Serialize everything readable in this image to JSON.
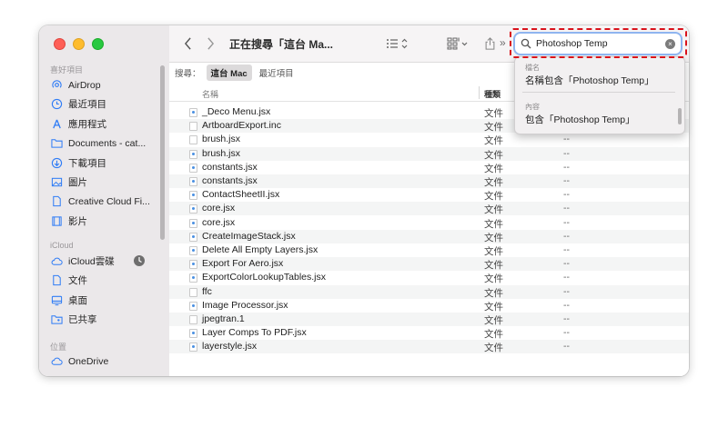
{
  "sidebar": {
    "section_favorites": "喜好項目",
    "favorites": [
      {
        "label": "AirDrop",
        "icon": "airdrop-icon"
      },
      {
        "label": "最近項目",
        "icon": "clock-icon"
      },
      {
        "label": "應用程式",
        "icon": "apps-icon"
      },
      {
        "label": "Documents - cat...",
        "icon": "folder-icon"
      },
      {
        "label": "下載項目",
        "icon": "download-icon"
      },
      {
        "label": "圖片",
        "icon": "photo-icon"
      },
      {
        "label": "Creative Cloud Fi...",
        "icon": "document-icon"
      },
      {
        "label": "影片",
        "icon": "film-icon"
      }
    ],
    "section_icloud": "iCloud",
    "icloud": [
      {
        "label": "iCloud雲碟",
        "icon": "cloud-icon"
      },
      {
        "label": "文件",
        "icon": "document-icon"
      },
      {
        "label": "桌面",
        "icon": "desktop-icon"
      },
      {
        "label": "已共享",
        "icon": "shared-folder-icon"
      }
    ],
    "section_locations": "位置",
    "locations": [
      {
        "label": "OneDrive",
        "icon": "cloud-icon"
      }
    ]
  },
  "toolbar": {
    "title": "正在搜尋「這台 Ma...",
    "more_glyph": "»"
  },
  "scope": {
    "label": "搜尋：",
    "selected": "這台 Mac",
    "other": "最近項目"
  },
  "columns": {
    "name": "名稱",
    "kind": "種類"
  },
  "files": [
    {
      "name": "_Deco Menu.jsx",
      "kind": "文件",
      "extra": "--",
      "js": true
    },
    {
      "name": "ArtboardExport.inc",
      "kind": "文件",
      "extra": "--",
      "js": false
    },
    {
      "name": "brush.jsx",
      "kind": "文件",
      "extra": "--",
      "js": false
    },
    {
      "name": "brush.jsx",
      "kind": "文件",
      "extra": "--",
      "js": true
    },
    {
      "name": "constants.jsx",
      "kind": "文件",
      "extra": "--",
      "js": true
    },
    {
      "name": "constants.jsx",
      "kind": "文件",
      "extra": "--",
      "js": true
    },
    {
      "name": "ContactSheetII.jsx",
      "kind": "文件",
      "extra": "--",
      "js": true
    },
    {
      "name": "core.jsx",
      "kind": "文件",
      "extra": "--",
      "js": true
    },
    {
      "name": "core.jsx",
      "kind": "文件",
      "extra": "--",
      "js": true
    },
    {
      "name": "CreateImageStack.jsx",
      "kind": "文件",
      "extra": "--",
      "js": true
    },
    {
      "name": "Delete All Empty Layers.jsx",
      "kind": "文件",
      "extra": "--",
      "js": true
    },
    {
      "name": "Export For Aero.jsx",
      "kind": "文件",
      "extra": "--",
      "js": true
    },
    {
      "name": "ExportColorLookupTables.jsx",
      "kind": "文件",
      "extra": "--",
      "js": true
    },
    {
      "name": "ffc",
      "kind": "文件",
      "extra": "--",
      "js": false
    },
    {
      "name": "Image Processor.jsx",
      "kind": "文件",
      "extra": "--",
      "js": true
    },
    {
      "name": "jpegtran.1",
      "kind": "文件",
      "extra": "--",
      "js": false
    },
    {
      "name": "Layer Comps To PDF.jsx",
      "kind": "文件",
      "extra": "--",
      "js": true
    },
    {
      "name": "layerstyle.jsx",
      "kind": "文件",
      "extra": "--",
      "js": true
    }
  ],
  "search": {
    "value": "Photoshop Temp",
    "clear_glyph": "×"
  },
  "suggestions": {
    "filename_header": "檔名",
    "filename_item": "名稱包含「Photoshop Temp」",
    "content_header": "內容",
    "content_item": "包含「Photoshop Temp」"
  },
  "colors": {
    "highlight": "#d9121b",
    "accent": "#2f7cf6"
  }
}
